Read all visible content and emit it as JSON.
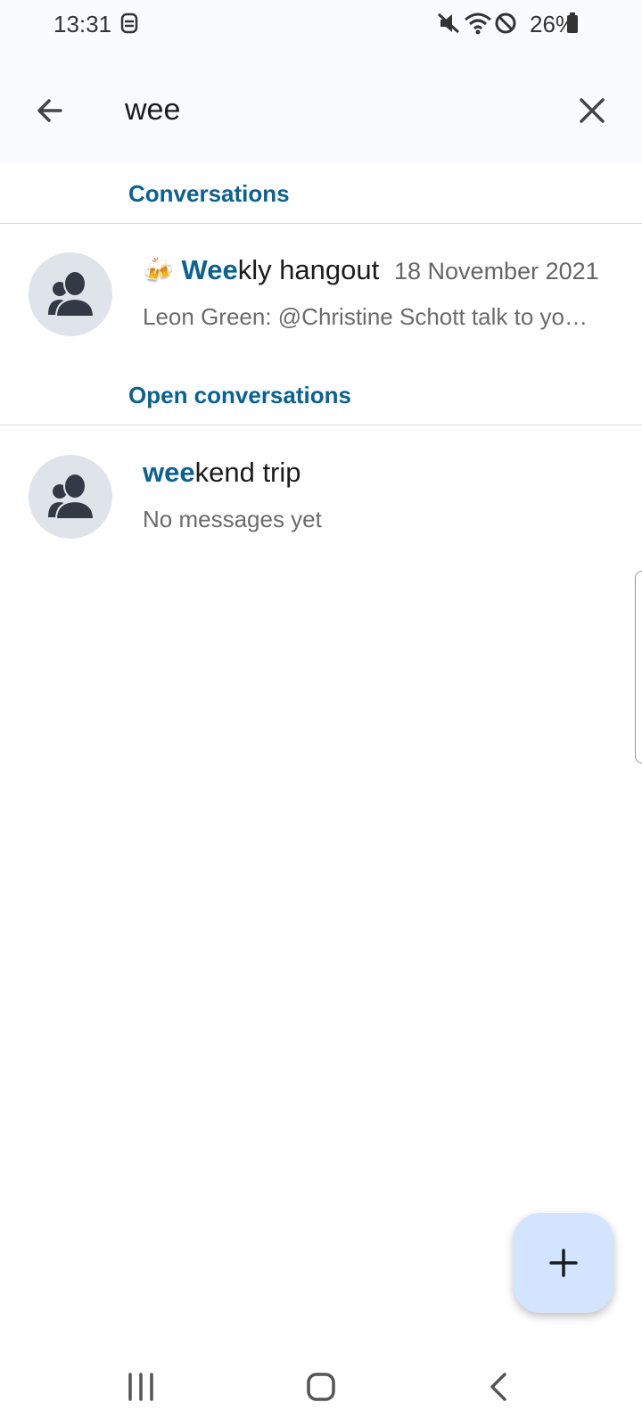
{
  "status_bar": {
    "time": "13:31",
    "battery": "26%",
    "icons": [
      "face-id-icon",
      "mute-icon",
      "wifi-icon",
      "do-not-disturb-icon",
      "battery-icon"
    ]
  },
  "search": {
    "value": "wee",
    "back_icon": "arrow-left-icon",
    "clear_icon": "close-icon"
  },
  "sections": {
    "conversations": "Conversations",
    "open_conversations": "Open conversations"
  },
  "conversations": [
    {
      "title_highlight": "Wee",
      "title_rest": "kly hangout",
      "emoji": "🍻",
      "date": "18 November 2021",
      "subtitle": "Leon Green: @Christine Schott talk to yo…"
    }
  ],
  "open_conversations": [
    {
      "title_highlight": "wee",
      "title_rest": "kend trip",
      "subtitle": "No messages yet"
    }
  ],
  "fab": {
    "icon": "plus-icon"
  },
  "nav": {
    "icons": [
      "recent-apps-icon",
      "home-icon",
      "back-icon"
    ]
  },
  "colors": {
    "accent": "#0a6192",
    "fab": "#d3e4ff",
    "avatar_bg": "#dfe3ea",
    "avatar_fg": "#333a45"
  }
}
